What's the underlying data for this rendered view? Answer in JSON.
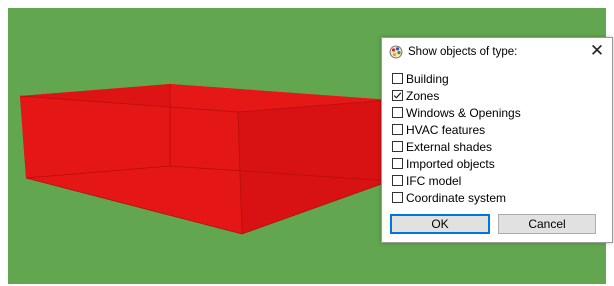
{
  "colors": {
    "ground": "#62a650",
    "box_front": "#e41616",
    "box_top": "#f31d1d",
    "box_right": "#d81212"
  },
  "dialog": {
    "title": "Show objects of type:",
    "title_icon": "palette-icon",
    "close_label": "✕",
    "options": [
      {
        "label": "Building",
        "checked": false
      },
      {
        "label": "Zones",
        "checked": true
      },
      {
        "label": "Windows & Openings",
        "checked": false
      },
      {
        "label": "HVAC features",
        "checked": false
      },
      {
        "label": "External shades",
        "checked": false
      },
      {
        "label": "Imported objects",
        "checked": false
      },
      {
        "label": "IFC model",
        "checked": false
      },
      {
        "label": "Coordinate system",
        "checked": false
      }
    ],
    "ok_label": "OK",
    "cancel_label": "Cancel"
  }
}
